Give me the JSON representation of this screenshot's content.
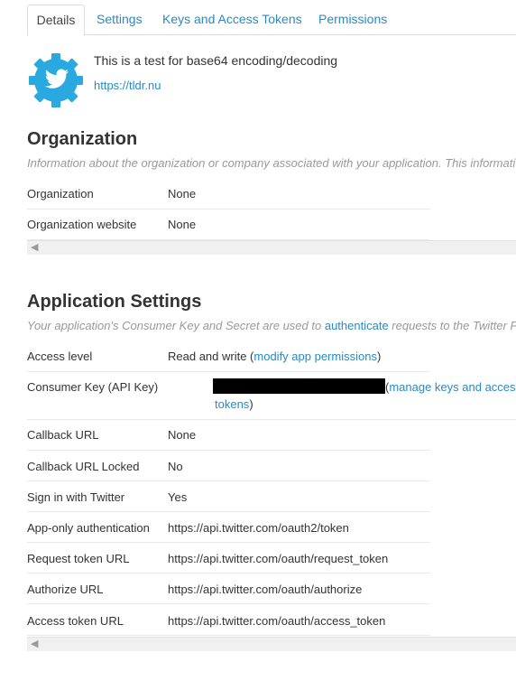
{
  "tabs": [
    {
      "label": "Details"
    },
    {
      "label": "Settings"
    },
    {
      "label": "Keys and Access Tokens"
    },
    {
      "label": "Permissions"
    }
  ],
  "app": {
    "description": "This is a test for base64 encoding/decoding",
    "url": "https://tldr.nu"
  },
  "organization": {
    "title": "Organization",
    "description": "Information about the organization or company associated with your application. This informati",
    "rows": [
      {
        "key": "Organization",
        "value": "None"
      },
      {
        "key": "Organization website",
        "value": "None"
      }
    ]
  },
  "app_settings": {
    "title": "Application Settings",
    "desc_before": "Your application's Consumer Key and Secret are used to ",
    "desc_link": "authenticate",
    "desc_after": " requests to the Twitter P",
    "access_level": {
      "key": "Access level",
      "value": "Read and write (",
      "link": "modify app permissions",
      "close": ")"
    },
    "consumer_key": {
      "key": "Consumer Key (API Key)",
      "open": "(",
      "link_part1": "manage keys and acces",
      "link_part2": "tokens",
      "close": ")"
    },
    "rows": [
      {
        "key": "Callback URL",
        "value": "None"
      },
      {
        "key": "Callback URL Locked",
        "value": "No"
      },
      {
        "key": "Sign in with Twitter",
        "value": "Yes"
      },
      {
        "key": "App-only authentication",
        "value": "https://api.twitter.com/oauth2/token"
      },
      {
        "key": "Request token URL",
        "value": "https://api.twitter.com/oauth/request_token"
      },
      {
        "key": "Authorize URL",
        "value": "https://api.twitter.com/oauth/authorize"
      },
      {
        "key": "Access token URL",
        "value": "https://api.twitter.com/oauth/access_token"
      }
    ]
  },
  "icons": {
    "app_icon": "twitter-bird-gear-icon",
    "scroll_left": "scroll-left-arrow-icon"
  },
  "colors": {
    "link": "#2a8ac3",
    "icon": "#2aa9e0",
    "muted": "#999999"
  }
}
